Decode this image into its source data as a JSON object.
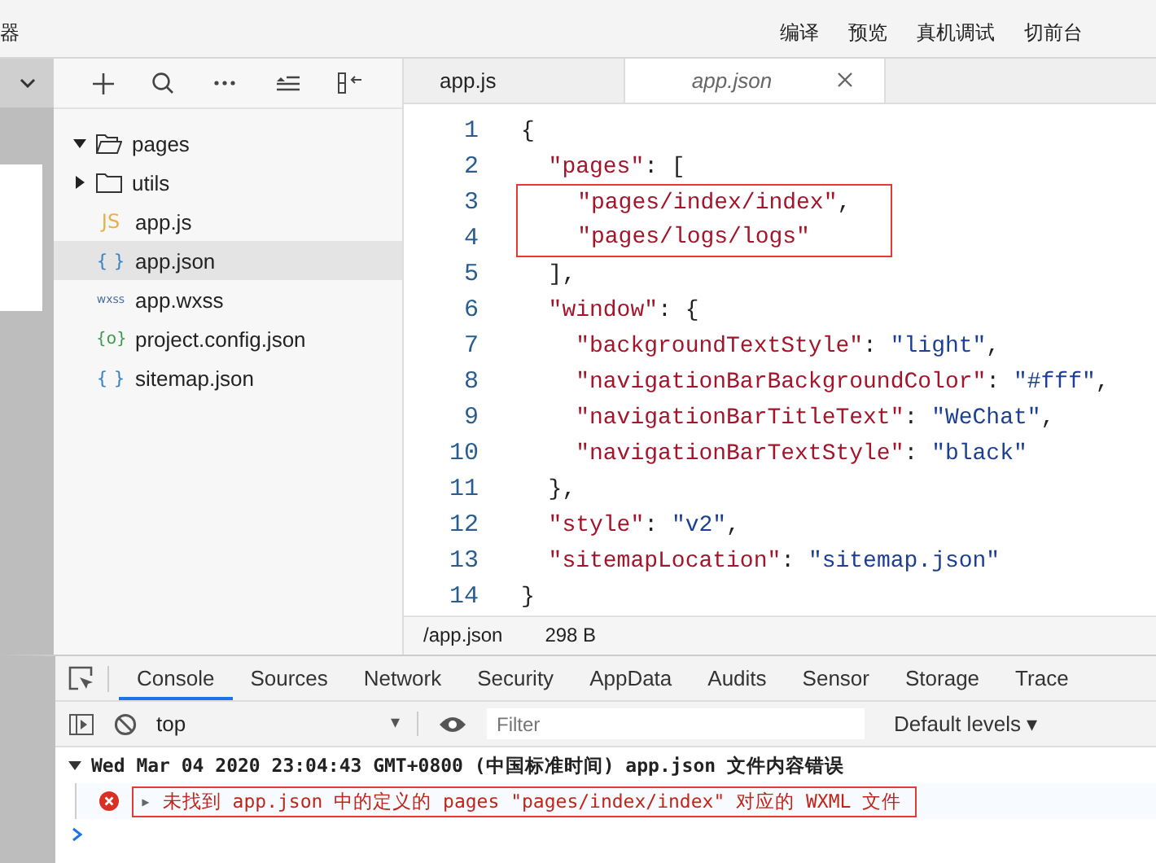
{
  "toolbar": {
    "left_label": "器",
    "buttons": [
      {
        "label": "编译"
      },
      {
        "label": "预览"
      },
      {
        "label": "真机调试"
      },
      {
        "label": "切前台"
      }
    ]
  },
  "explorer": {
    "items": [
      {
        "label": "pages",
        "kind": "folder",
        "expanded": true,
        "selected": false
      },
      {
        "label": "utils",
        "kind": "folder",
        "expanded": false,
        "selected": false
      },
      {
        "label": "app.js",
        "kind": "js",
        "icon_text": "JS",
        "selected": false
      },
      {
        "label": "app.json",
        "kind": "json",
        "icon_text": "{ }",
        "selected": true
      },
      {
        "label": "app.wxss",
        "kind": "wxss",
        "icon_text": "wxss",
        "selected": false
      },
      {
        "label": "project.config.json",
        "kind": "config",
        "icon_text": "{o}",
        "selected": false
      },
      {
        "label": "sitemap.json",
        "kind": "json",
        "icon_text": "{ }",
        "selected": false
      }
    ]
  },
  "editor_tabs": [
    {
      "label": "app.js",
      "selected": false
    },
    {
      "label": "app.json",
      "selected": true
    }
  ],
  "code_lines": [
    {
      "number": "1",
      "boxed": false,
      "tokens": [
        {
          "kind": "punct",
          "text": "{"
        }
      ]
    },
    {
      "number": "2",
      "boxed": false,
      "tokens": [
        {
          "kind": "key",
          "text": "  \"pages\""
        },
        {
          "kind": "punct",
          "text": ": ["
        }
      ]
    },
    {
      "number": "3",
      "boxed": true,
      "tokens": [
        {
          "kind": "key",
          "text": "    \"pages/index/index\""
        },
        {
          "kind": "punct",
          "text": ","
        }
      ]
    },
    {
      "number": "4",
      "boxed": true,
      "tokens": [
        {
          "kind": "key",
          "text": "    \"pages/logs/logs\""
        }
      ]
    },
    {
      "number": "5",
      "boxed": false,
      "tokens": [
        {
          "kind": "punct",
          "text": "  ],"
        }
      ]
    },
    {
      "number": "6",
      "boxed": false,
      "tokens": [
        {
          "kind": "key",
          "text": "  \"window\""
        },
        {
          "kind": "punct",
          "text": ": {"
        }
      ]
    },
    {
      "number": "7",
      "boxed": false,
      "tokens": [
        {
          "kind": "key",
          "text": "    \"backgroundTextStyle\""
        },
        {
          "kind": "punct",
          "text": ": "
        },
        {
          "kind": "string",
          "text": "\"light\""
        },
        {
          "kind": "punct",
          "text": ","
        }
      ]
    },
    {
      "number": "8",
      "boxed": false,
      "tokens": [
        {
          "kind": "key",
          "text": "    \"navigationBarBackgroundColor\""
        },
        {
          "kind": "punct",
          "text": ": "
        },
        {
          "kind": "string",
          "text": "\"#fff\""
        },
        {
          "kind": "punct",
          "text": ","
        }
      ]
    },
    {
      "number": "9",
      "boxed": false,
      "tokens": [
        {
          "kind": "key",
          "text": "    \"navigationBarTitleText\""
        },
        {
          "kind": "punct",
          "text": ": "
        },
        {
          "kind": "string",
          "text": "\"WeChat\""
        },
        {
          "kind": "punct",
          "text": ","
        }
      ]
    },
    {
      "number": "10",
      "boxed": false,
      "tokens": [
        {
          "kind": "key",
          "text": "    \"navigationBarTextStyle\""
        },
        {
          "kind": "punct",
          "text": ": "
        },
        {
          "kind": "string",
          "text": "\"black\""
        }
      ]
    },
    {
      "number": "11",
      "boxed": false,
      "tokens": [
        {
          "kind": "punct",
          "text": "  },"
        }
      ]
    },
    {
      "number": "12",
      "boxed": false,
      "tokens": [
        {
          "kind": "key",
          "text": "  \"style\""
        },
        {
          "kind": "punct",
          "text": ": "
        },
        {
          "kind": "string",
          "text": "\"v2\""
        },
        {
          "kind": "punct",
          "text": ","
        }
      ]
    },
    {
      "number": "13",
      "boxed": false,
      "tokens": [
        {
          "kind": "key",
          "text": "  \"sitemapLocation\""
        },
        {
          "kind": "punct",
          "text": ": "
        },
        {
          "kind": "string",
          "text": "\"sitemap.json\""
        }
      ]
    },
    {
      "number": "14",
      "boxed": false,
      "tokens": [
        {
          "kind": "punct",
          "text": "}"
        }
      ]
    }
  ],
  "status_bar": {
    "path": "/app.json",
    "size": "298 B"
  },
  "devtools": {
    "tabs": [
      {
        "label": "Console",
        "selected": true
      },
      {
        "label": "Sources",
        "selected": false
      },
      {
        "label": "Network",
        "selected": false
      },
      {
        "label": "Security",
        "selected": false
      },
      {
        "label": "AppData",
        "selected": false
      },
      {
        "label": "Audits",
        "selected": false
      },
      {
        "label": "Sensor",
        "selected": false
      },
      {
        "label": "Storage",
        "selected": false
      },
      {
        "label": "Trace",
        "selected": false
      }
    ],
    "context": "top",
    "context_arrow": "▾",
    "filter_placeholder": "Filter",
    "levels": "Default levels ▾",
    "group_header": "Wed Mar 04 2020 23:04:43 GMT+0800 (中国标准时间)  app.json 文件内容错误",
    "messages": [
      {
        "kind": "error",
        "expander": "▸",
        "text": "未找到 app.json 中的定义的 pages \"pages/index/index\" 对应的 WXML 文件"
      }
    ]
  }
}
